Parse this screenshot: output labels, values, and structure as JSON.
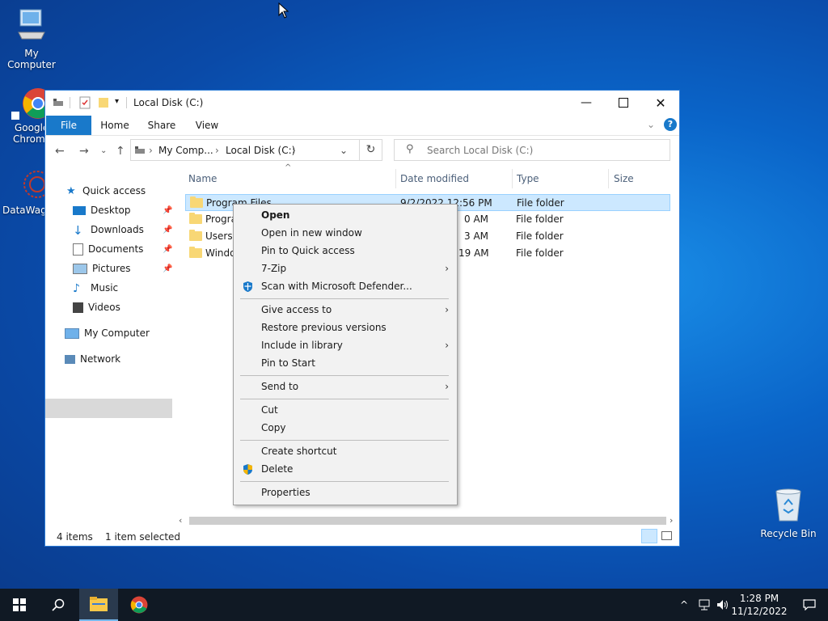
{
  "desktop": {
    "icons": [
      {
        "label": "My Computer"
      },
      {
        "label": "Google Chrome",
        "short1": "Google",
        "short2": "Chrom"
      },
      {
        "label": "DataWago",
        "short": "DataWago"
      },
      {
        "label": "Recycle Bin"
      }
    ]
  },
  "window": {
    "title": "Local Disk (C:)",
    "tabs": [
      "File",
      "Home",
      "Share",
      "View"
    ],
    "breadcrumb": [
      "My Comp...",
      "Local Disk (C:)"
    ],
    "search_placeholder": "Search Local Disk (C:)",
    "nav": {
      "quick_access": "Quick access",
      "items": [
        "Desktop",
        "Downloads",
        "Documents",
        "Pictures",
        "Music",
        "Videos"
      ],
      "my_computer": "My Computer",
      "network": "Network"
    },
    "columns": [
      "Name",
      "Date modified",
      "Type",
      "Size"
    ],
    "rows": [
      {
        "name": "Program Files",
        "date": "9/2/2022 12:56 PM",
        "type": "File folder"
      },
      {
        "name": "Progra",
        "date": "0 AM",
        "type": "File folder"
      },
      {
        "name": "Users",
        "date": "3 AM",
        "type": "File folder"
      },
      {
        "name": "Windo",
        "date": "19 AM",
        "type": "File folder"
      }
    ],
    "status": {
      "items": "4 items",
      "selected": "1 item selected"
    }
  },
  "context_menu": {
    "open": "Open",
    "open_new_window": "Open in new window",
    "pin_quick": "Pin to Quick access",
    "zip": "7-Zip",
    "scan": "Scan with Microsoft Defender...",
    "give_access": "Give access to",
    "restore": "Restore previous versions",
    "include_library": "Include in library",
    "pin_start": "Pin to Start",
    "send_to": "Send to",
    "cut": "Cut",
    "copy": "Copy",
    "create_shortcut": "Create shortcut",
    "delete": "Delete",
    "properties": "Properties"
  },
  "taskbar": {
    "time": "1:28 PM",
    "date": "11/12/2022"
  }
}
